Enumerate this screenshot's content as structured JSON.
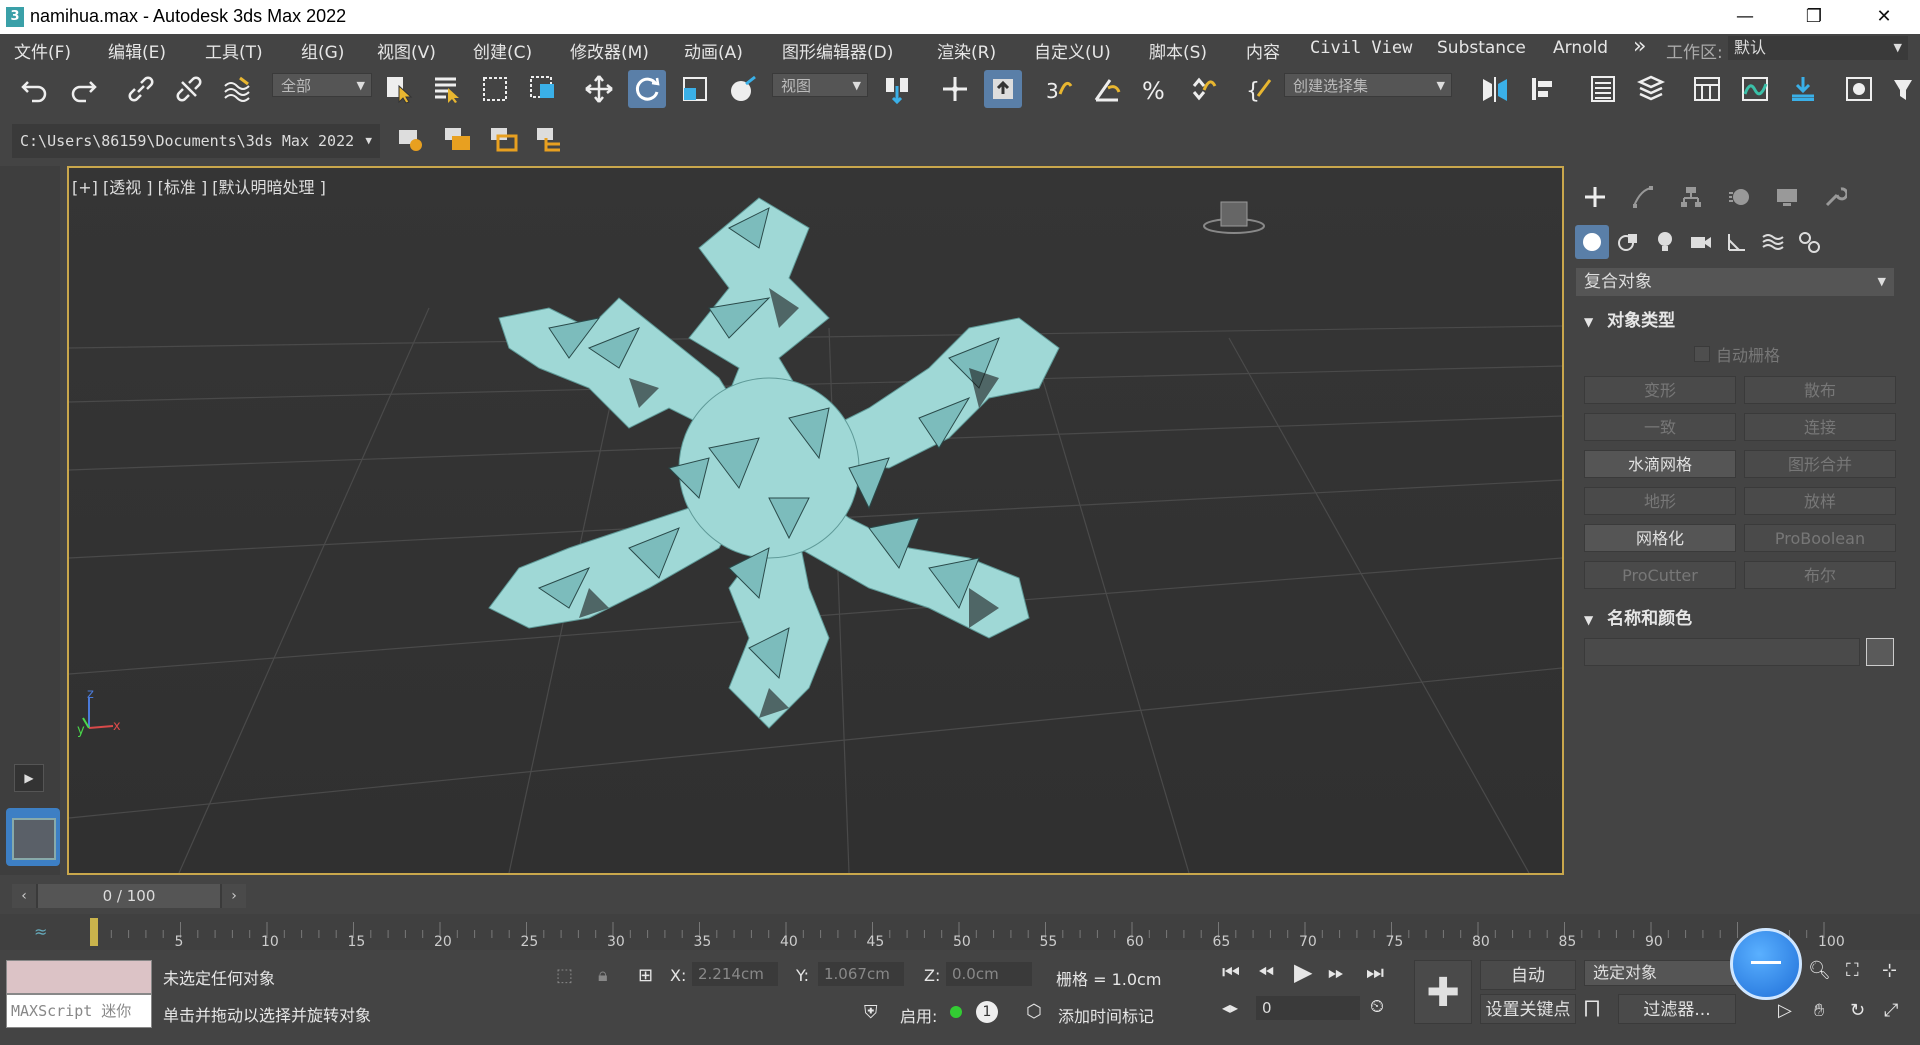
{
  "window": {
    "title": "namihua.max - Autodesk 3ds Max 2022",
    "app_icon_glyph": "3"
  },
  "menu": {
    "items": [
      "文件(F)",
      "编辑(E)",
      "工具(T)",
      "组(G)",
      "视图(V)",
      "创建(C)",
      "修改器(M)",
      "动画(A)",
      "图形编辑器(D)",
      "渲染(R)",
      "自定义(U)",
      "脚本(S)",
      "内容",
      "Civil View",
      "Substance",
      "Arnold"
    ],
    "overflow": "»",
    "workspace_label": "工作区:",
    "workspace_value": "默认"
  },
  "toolbar": {
    "selection_filter": "全部",
    "ref_coord": "视图",
    "named_selection": "创建选择集"
  },
  "path": {
    "project_path": "C:\\Users\\86159\\Documents\\3ds Max 2022"
  },
  "viewport": {
    "label": "[+] [透视 ] [标准 ] [默认明暗处理 ]",
    "axis_x": "x",
    "axis_y": "y",
    "axis_z": "z",
    "object_color": "#9fd8d6",
    "border_color": "#c9a74c"
  },
  "command_panel": {
    "category": "复合对象",
    "object_type_header": "对象类型",
    "auto_grid": "自动栅格",
    "buttons": [
      {
        "label": "变形",
        "enabled": false
      },
      {
        "label": "散布",
        "enabled": false
      },
      {
        "label": "一致",
        "enabled": false
      },
      {
        "label": "连接",
        "enabled": false
      },
      {
        "label": "水滴网格",
        "enabled": true
      },
      {
        "label": "图形合并",
        "enabled": false
      },
      {
        "label": "地形",
        "enabled": false
      },
      {
        "label": "放样",
        "enabled": false
      },
      {
        "label": "网格化",
        "enabled": true
      },
      {
        "label": "ProBoolean",
        "enabled": false
      },
      {
        "label": "ProCutter",
        "enabled": false
      },
      {
        "label": "布尔",
        "enabled": false
      }
    ],
    "name_color_header": "名称和颜色"
  },
  "timeline": {
    "frame_display": "0 / 100",
    "ticks": [
      "5",
      "10",
      "15",
      "20",
      "25",
      "30",
      "35",
      "40",
      "45",
      "50",
      "55",
      "60",
      "65",
      "70",
      "75",
      "80",
      "85",
      "90",
      "100"
    ]
  },
  "status": {
    "selection": "未选定任何对象",
    "prompt": "单击并拖动以选择并旋转对象",
    "maxscript": "MAXScript 迷你",
    "x_label": "X:",
    "x_value": "2.214cm",
    "y_label": "Y:",
    "y_value": "1.067cm",
    "z_label": "Z:",
    "z_value": "0.0cm",
    "grid": "栅格 = 1.0cm",
    "enable_label": "启用:",
    "enable_badge": "1",
    "add_time_tag": "添加时间标记",
    "auto_key": "自动",
    "set_key": "设置关键点",
    "selected_objects": "选定对象",
    "filters": "过滤器...",
    "frame_value": "0"
  }
}
